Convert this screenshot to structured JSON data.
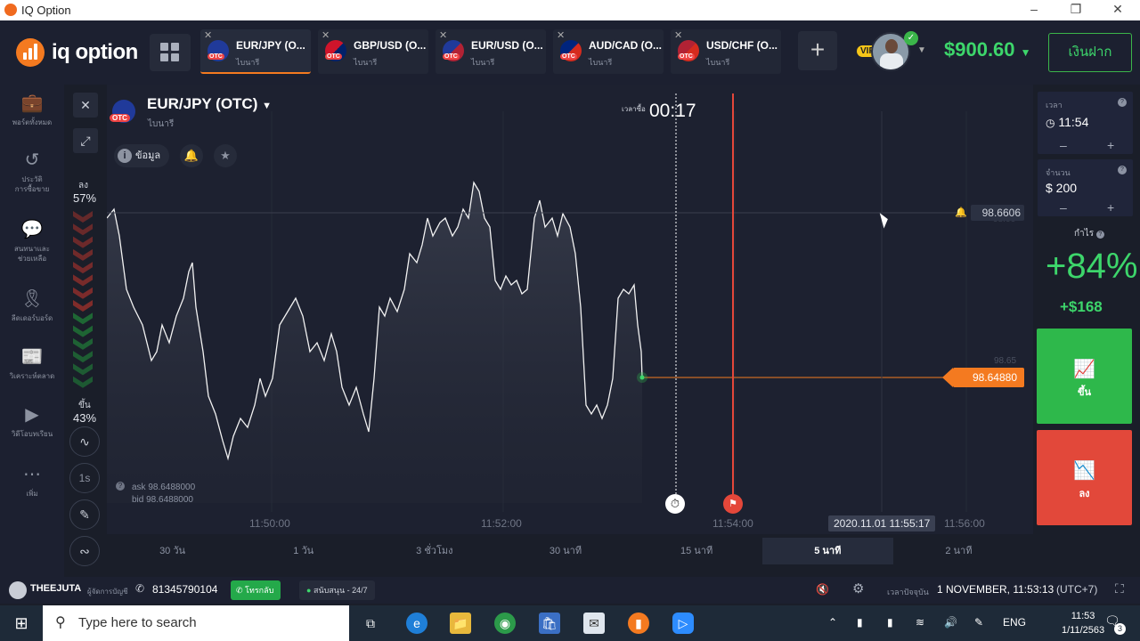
{
  "window": {
    "title": "IQ Option",
    "minimize_icon": "minimize-icon",
    "restore_icon": "restore-icon",
    "close_icon": "close-icon"
  },
  "header": {
    "logo_text": "iq option",
    "tabs": [
      {
        "name": "EUR/JPY (O...",
        "sub": "ไบนารี",
        "active": true
      },
      {
        "name": "GBP/USD (O...",
        "sub": "ไบนารี",
        "active": false
      },
      {
        "name": "EUR/USD (O...",
        "sub": "ไบนารี",
        "active": false
      },
      {
        "name": "AUD/CAD (O...",
        "sub": "ไบนารี",
        "active": false
      },
      {
        "name": "USD/CHF (O...",
        "sub": "ไบนารี",
        "active": false
      }
    ],
    "otc_badge": "OTC",
    "vip": "VIP",
    "balance": "$900.60",
    "deposit_label": "เงินฝาก"
  },
  "sidebar": {
    "items": [
      {
        "icon": "briefcase-icon",
        "label": "พอร์ตทั้งหมด"
      },
      {
        "icon": "history-icon",
        "label": "ประวัติ\nการซื้อขาย"
      },
      {
        "icon": "chat-icon",
        "label": "สนทนาและ\nช่วยเหลือ"
      },
      {
        "icon": "ribbon-icon",
        "label": "ลีดเดอร์บอร์ด"
      },
      {
        "icon": "news-icon",
        "label": "วิเคราะห์ตลาด"
      },
      {
        "icon": "play-icon",
        "label": "วิดีโอบทเรียน"
      },
      {
        "icon": "more-icon",
        "label": "เพิ่ม"
      }
    ]
  },
  "sentiment": {
    "down_label": "ลง",
    "down_pct": "57%",
    "up_label": "ขึ้น",
    "up_pct": "43%",
    "down_fraction": 0.57
  },
  "tools": {
    "interval": "1s"
  },
  "chart": {
    "asset": "EUR/JPY (OTC)",
    "asset_type": "ไบนารี",
    "info_label": "ข้อมูล",
    "timer_label": "เวลาซื้อ",
    "timer_value": "00:17",
    "alert_price": "98.6606",
    "current_price": "98.64880",
    "scale_hint": "98.65",
    "scale_hint_top": "98.66",
    "ask": "ask 98.6488000",
    "bid": "bid 98.6488000",
    "time_labels": [
      "11:50:00",
      "11:52:00",
      "11:54:00",
      "11:56:00"
    ],
    "cursor_time": "2020.11.01 11:55:17"
  },
  "periods": [
    {
      "label": "30 วัน",
      "active": false
    },
    {
      "label": "1 วัน",
      "active": false
    },
    {
      "label": "3 ชั่วโมง",
      "active": false
    },
    {
      "label": "30 นาที",
      "active": false
    },
    {
      "label": "15 นาที",
      "active": false
    },
    {
      "label": "5 นาที",
      "active": true
    },
    {
      "label": "2 นาที",
      "active": false
    }
  ],
  "trade": {
    "time_label": "เวลา",
    "time_value": "11:54",
    "amount_label": "จำนวน",
    "amount_value": "$  200",
    "profit_label": "กำไร",
    "profit_pct": "+84%",
    "profit_amount": "+$168",
    "up_label": "ขึ้น",
    "down_label": "ลง"
  },
  "status": {
    "username": "THEEJUTA",
    "manager_label": "ผู้จัดการบัญชี",
    "phone": "81345790104",
    "whatsapp_label": "โทรกลับ",
    "support_label": "สนับสนุน - 24/7",
    "current_time_label": "เวลาปัจจุบัน",
    "current_time": "1 NOVEMBER, 11:53:13",
    "timezone": "(UTC+7)"
  },
  "taskbar": {
    "search_placeholder": "Type here to search",
    "lang": "ENG",
    "time": "11:53",
    "date": "1/11/2563",
    "notif_count": "3"
  },
  "colors": {
    "up": "#2eb84b",
    "down": "#e2483a",
    "accent": "#f47a20",
    "balance": "#3dd66b"
  }
}
